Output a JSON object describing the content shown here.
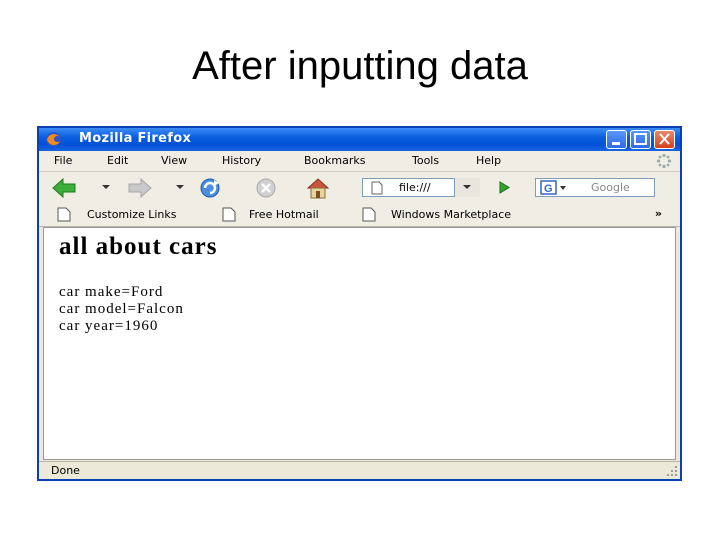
{
  "slide": {
    "title": "After inputting data"
  },
  "window": {
    "title": "Mozilla Firefox",
    "menu": [
      "File",
      "Edit",
      "View",
      "History",
      "Bookmarks",
      "Tools",
      "Help"
    ],
    "address": "file:///",
    "search_placeholder": "Google",
    "bookmarks": [
      "Customize Links",
      "Free Hotmail",
      "Windows Marketplace"
    ],
    "bookmarks_overflow": "»",
    "status": "Done"
  },
  "page": {
    "heading": "all about cars",
    "lines": [
      "car make=Ford",
      "car model=Falcon",
      "car year=1960"
    ]
  }
}
